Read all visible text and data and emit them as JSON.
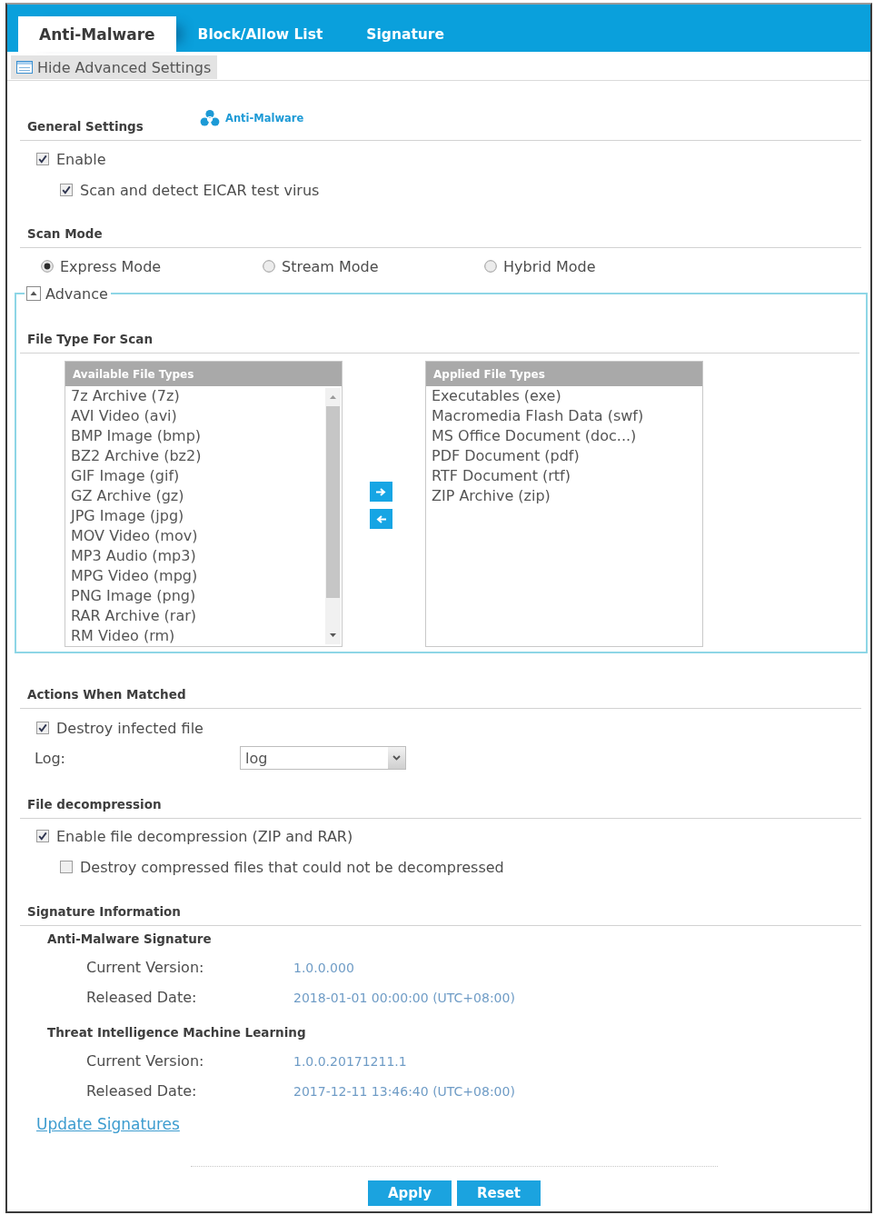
{
  "tabs": [
    {
      "label": "Anti-Malware",
      "selected": true
    },
    {
      "label": "Block/Allow List",
      "selected": false
    },
    {
      "label": "Signature",
      "selected": false
    }
  ],
  "advanced_toggle": {
    "label": "Hide Advanced Settings"
  },
  "general_settings": {
    "title": "General Settings",
    "link": "Anti-Malware",
    "options": [
      {
        "label": "Enable",
        "checked": true,
        "children": [
          {
            "label": "Scan and detect EICAR test virus",
            "checked": true
          }
        ]
      }
    ]
  },
  "scan_mode": {
    "title": "Scan Mode",
    "options": [
      {
        "label": "Express Mode",
        "selected": true
      },
      {
        "label": "Stream Mode",
        "selected": false
      },
      {
        "label": "Hybrid Mode",
        "selected": false
      }
    ]
  },
  "advance": {
    "legend": "Advance",
    "expanded": true,
    "title": "File Type For Scan",
    "available": {
      "header": "Available File Types",
      "items": [
        {
          "label": "7z Archive (7z)",
          "selected": false
        },
        {
          "label": "AVI Video (avi)",
          "selected": false
        },
        {
          "label": "BMP Image (bmp)",
          "selected": false
        },
        {
          "label": "BZ2 Archive (bz2)",
          "selected": false
        },
        {
          "label": "GIF Image (gif)",
          "selected": false
        },
        {
          "label": "GZ Archive (gz)",
          "selected": false
        },
        {
          "label": "JPG Image (jpg)",
          "selected": false
        },
        {
          "label": "MOV Video (mov)",
          "selected": false
        },
        {
          "label": "MP3 Audio (mp3)",
          "selected": false
        },
        {
          "label": "MPG Video (mpg)",
          "selected": false
        },
        {
          "label": "PNG Image (png)",
          "selected": false
        },
        {
          "label": "RAR Archive (rar)",
          "selected": false
        },
        {
          "label": "RM Video (rm)",
          "selected": false
        }
      ]
    },
    "applied": {
      "header": "Applied File Types",
      "items": [
        {
          "label": "Executables (exe)",
          "selected": false
        },
        {
          "label": "Macromedia Flash Data (swf)",
          "selected": false
        },
        {
          "label": "MS Office Document (doc...)",
          "selected": false
        },
        {
          "label": "PDF Document (pdf)",
          "selected": false
        },
        {
          "label": "RTF Document (rtf)",
          "selected": false
        },
        {
          "label": "ZIP Archive (zip)",
          "selected": false
        }
      ]
    }
  },
  "actions_when_matched": {
    "title": "Actions When Matched",
    "options": [
      {
        "label": "Destroy infected file",
        "checked": true
      }
    ],
    "log": {
      "label": "Log:",
      "value": "log"
    }
  },
  "file_decompression": {
    "title": "File decompression",
    "options": [
      {
        "label": "Enable file decompression (ZIP and RAR)",
        "checked": true,
        "children": [
          {
            "label": "Destroy compressed files that could not be decompressed",
            "checked": false
          }
        ]
      }
    ]
  },
  "signature_information": {
    "title": "Signature Information",
    "groups": [
      {
        "title": "Anti-Malware Signature",
        "fields": [
          {
            "label": "Current Version:",
            "value": "1.0.0.000"
          },
          {
            "label": "Released Date:",
            "value": "2018-01-01 00:00:00 (UTC+08:00)"
          }
        ]
      },
      {
        "title": "Threat Intelligence Machine Learning",
        "fields": [
          {
            "label": "Current Version:",
            "value": "1.0.0.20171211.1"
          },
          {
            "label": "Released Date:",
            "value": "2017-12-11 13:46:40 (UTC+08:00)"
          }
        ]
      }
    ],
    "link": "Update Signatures"
  },
  "buttons": [
    {
      "label": "Apply"
    },
    {
      "label": "Reset"
    }
  ]
}
